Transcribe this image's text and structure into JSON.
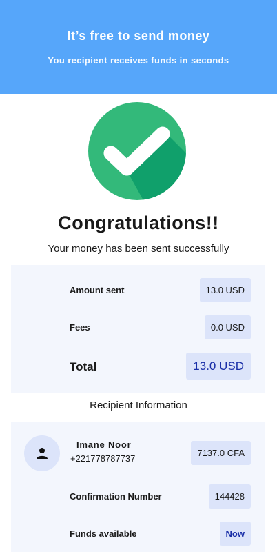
{
  "banner": {
    "title": "It’s free to send money",
    "subtitle": "You recipient receives funds in seconds"
  },
  "success": {
    "icon": "check-circle-icon",
    "icon_color": "#33b97a",
    "title": "Congratulations!!",
    "message": "Your money has been sent successfully"
  },
  "summary": {
    "amount_label": "Amount sent",
    "amount_value": "13.0 USD",
    "fees_label": "Fees",
    "fees_value": "0.0 USD",
    "total_label": "Total",
    "total_value": "13.0 USD"
  },
  "recipient": {
    "section_title": "Recipient Information",
    "avatar_icon": "person-icon",
    "name": "Imane Noor",
    "phone": "+221778787737",
    "received_amount": "7137.0 CFA",
    "confirmation_label": "Confirmation Number",
    "confirmation_value": "144428",
    "funds_label": "Funds available",
    "funds_value": "Now"
  },
  "colors": {
    "banner": "#56a6fa",
    "card_bg": "#f3f6fd",
    "pill_bg": "#dce4fa",
    "accent_text": "#1a2fa8"
  }
}
